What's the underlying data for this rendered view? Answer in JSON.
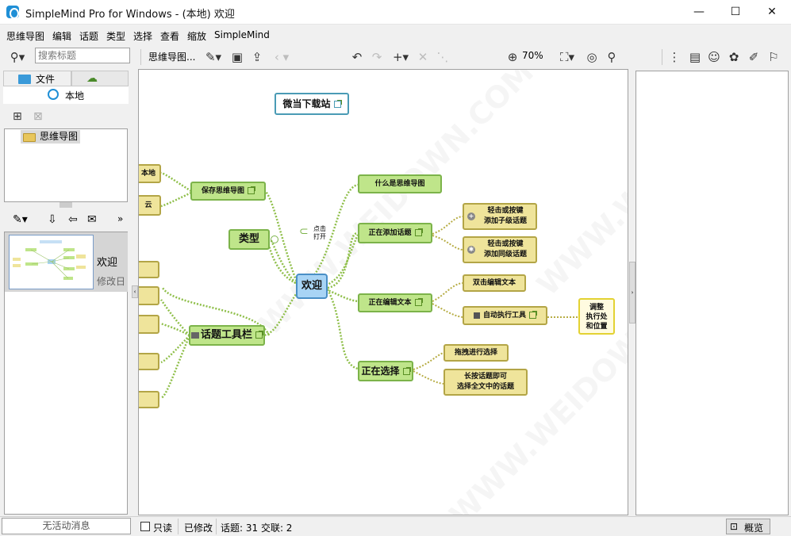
{
  "window": {
    "title": "SimpleMind Pro for Windows - (本地) 欢迎",
    "minimize": "—",
    "maximize": "☐",
    "close": "✕"
  },
  "menu": [
    "思维导图",
    "编辑",
    "话题",
    "类型",
    "选择",
    "查看",
    "缩放",
    "SimpleMind"
  ],
  "toolbar": {
    "search_placeholder": "搜索标题",
    "breadcrumb": "思维导图...",
    "zoom": "70%"
  },
  "left_panel": {
    "tab_files": "文件",
    "location": "本地",
    "tree_item": "思维导图",
    "map_title": "欢迎",
    "map_subtitle": "修改日",
    "footer": "无活动消息"
  },
  "canvas": {
    "watermark": "WWW.WEIDOWN.COM",
    "nodes": {
      "top_box": "微当下载站",
      "center": "欢迎",
      "save": "保存思维导图",
      "type": "类型",
      "topic_toolbar": "话题工具栏",
      "click_open_1": "点击",
      "click_open_2": "打开",
      "what_is": "什么是思维导图",
      "adding": "正在添加话题",
      "add1_l1": "轻击或按键",
      "add1_l2": "添加子级话题",
      "add2_l1": "轻击或按键",
      "add2_l2": "添加同级话题",
      "editing": "正在编辑文本",
      "dbl": "双击编辑文本",
      "autotool": "自动执行工具",
      "note_l1": "调整",
      "note_l2": "执行处",
      "note_l3": "和位置",
      "selecting": "正在选择",
      "drag": "拖拽进行选择",
      "multi_l1": "长按话题即可",
      "multi_l2": "选择全文中的话题",
      "left_cut_1": "本地",
      "left_cut_2": "云"
    }
  },
  "status": {
    "readonly": "只读",
    "modified": "已修改",
    "counts": "话题: 31 交联: 2",
    "overview": "概览"
  },
  "colors": {
    "accent": "#1f8fd6",
    "node_green": "#bfe58a",
    "node_yellow": "#efe49b",
    "center_blue": "#a8d4f5"
  }
}
